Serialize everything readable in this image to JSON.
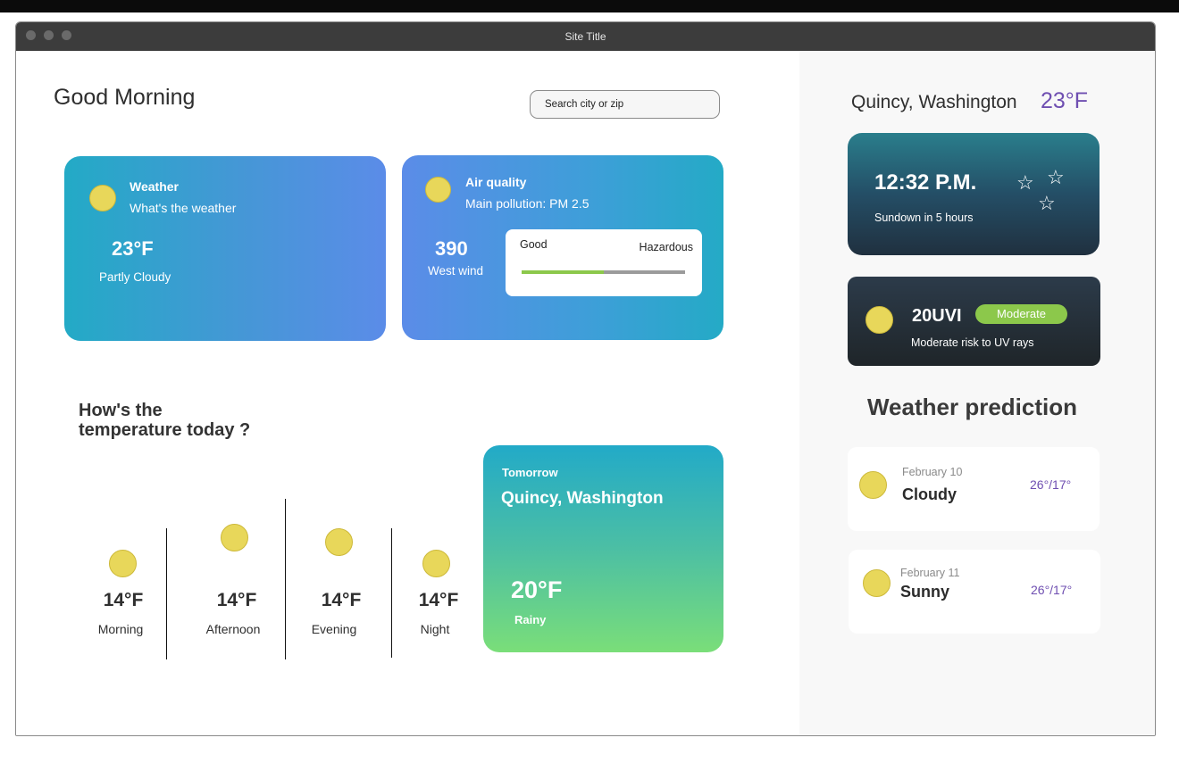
{
  "window": {
    "title": "Site Title"
  },
  "header": {
    "greeting": "Good Morning",
    "search_placeholder": "Search city or zip"
  },
  "weather_card": {
    "title": "Weather",
    "subtitle": "What's the weather",
    "temp": "23°F",
    "condition": "Partly Cloudy",
    "icon": "sun-icon"
  },
  "air_card": {
    "title": "Air quality",
    "subtitle": "Main pollution: PM 2.5",
    "value": "390",
    "wind": "West wind",
    "scale_low": "Good",
    "scale_high": "Hazardous",
    "level_fraction": 0.5,
    "icon": "sun-icon"
  },
  "today": {
    "heading_line1": "How's the",
    "heading_line2": "temperature today ?",
    "periods": [
      {
        "temp": "14°F",
        "label": "Morning"
      },
      {
        "temp": "14°F",
        "label": "Afternoon"
      },
      {
        "temp": "14°F",
        "label": "Evening"
      },
      {
        "temp": "14°F",
        "label": "Night"
      }
    ]
  },
  "tomorrow": {
    "label": "Tomorrow",
    "location": "Quincy, Washington",
    "temp": "20°F",
    "condition": "Rainy"
  },
  "sidebar": {
    "location": "Quincy, Washington",
    "temp": "23°F",
    "clock": {
      "time": "12:32 P.M.",
      "sundown": "Sundown in 5 hours"
    },
    "uv": {
      "value": "20UVI",
      "badge": "Moderate",
      "note": "Moderate risk to UV rays"
    },
    "prediction_title": "Weather prediction",
    "predictions": [
      {
        "date": "February 10",
        "condition": "Cloudy",
        "range": "26°/17°"
      },
      {
        "date": "February 11",
        "condition": "Sunny",
        "range": "26°/17°"
      }
    ]
  },
  "colors": {
    "accent_purple": "#6f4fb1",
    "good_green": "#8cc84b",
    "sun_yellow": "#e8d75a"
  }
}
